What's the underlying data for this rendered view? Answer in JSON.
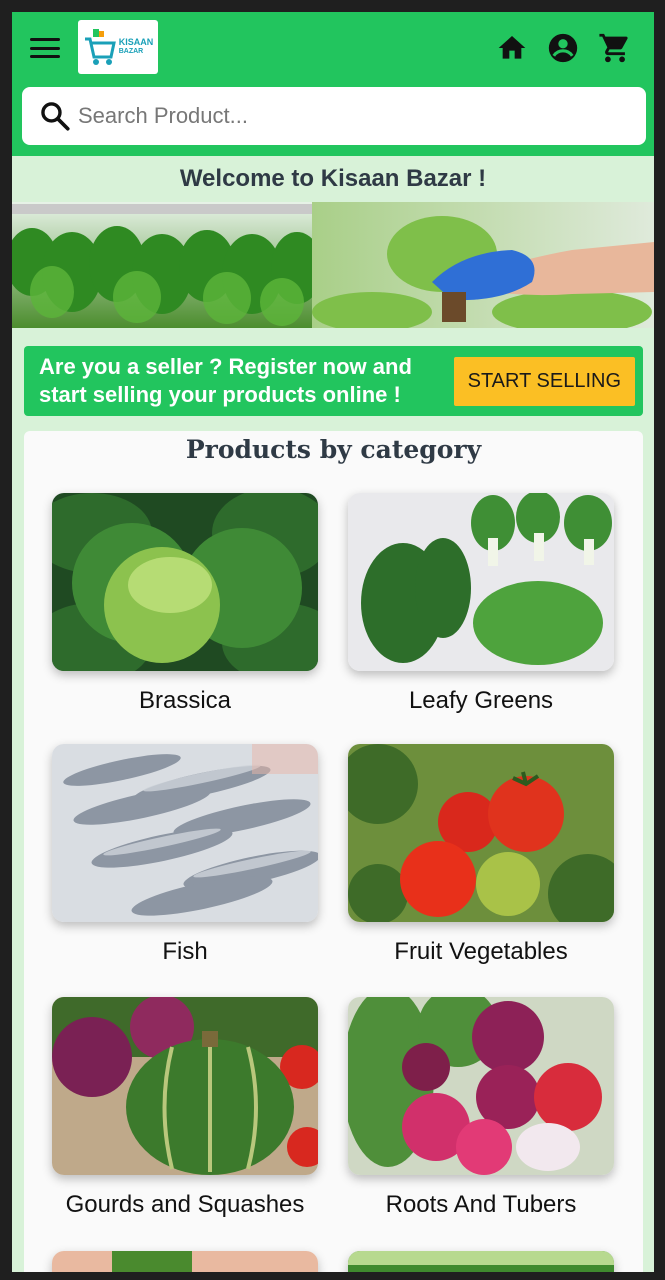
{
  "header": {
    "logo_line1": "KISAAN",
    "logo_line2": "BAZAR"
  },
  "search": {
    "placeholder": "Search Product..."
  },
  "welcome": "Welcome to Kisaan Bazar !",
  "seller": {
    "text": "Are you a seller ? Register now and start selling your products online !",
    "button": "START SELLING"
  },
  "categories": {
    "title": "Products by category",
    "items": [
      {
        "label": "Brassica"
      },
      {
        "label": "Leafy Greens"
      },
      {
        "label": "Fish"
      },
      {
        "label": "Fruit Vegetables"
      },
      {
        "label": "Gourds and Squashes"
      },
      {
        "label": "Roots And Tubers"
      }
    ]
  },
  "colors": {
    "primary": "#22c55e",
    "accent": "#fbbf24",
    "background": "#d8f2d8"
  },
  "icons": [
    "menu-icon",
    "cart-logo-icon",
    "home-icon",
    "account-icon",
    "cart-icon",
    "search-icon"
  ]
}
